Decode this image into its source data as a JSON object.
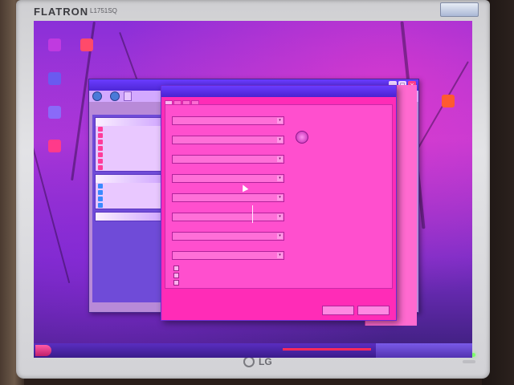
{
  "monitor": {
    "brand": "FLATRON",
    "model": "L1751SQ",
    "badge": "",
    "logo": "LG"
  },
  "desktop": {
    "icons": [
      {
        "label": "",
        "icon": "computer-icon",
        "color": "#c03ae0"
      },
      {
        "label": "",
        "icon": "documents-icon",
        "color": "#ff4a6a"
      },
      {
        "label": "",
        "icon": "network-icon",
        "color": "#6a5af0"
      },
      {
        "label": "",
        "icon": "recycle-bin-icon",
        "color": "#8a6af8"
      },
      {
        "label": "",
        "icon": "internet-icon",
        "color": "#ff3a8a"
      },
      {
        "label": "",
        "icon": "program-icon",
        "color": "#ff5a30"
      }
    ]
  },
  "explorer_window": {
    "title": "",
    "toolbar": {
      "back_label": "",
      "address_label": ""
    },
    "taskpane": {
      "sections": [
        {
          "header": "",
          "items": [
            "",
            "",
            "",
            "",
            "",
            "",
            ""
          ]
        },
        {
          "header": "",
          "items": [
            "",
            "",
            "",
            ""
          ]
        },
        {
          "header": "",
          "items": []
        }
      ]
    }
  },
  "dialog": {
    "title": "",
    "tabs": [
      "",
      "",
      "",
      ""
    ],
    "active_tab": 0,
    "fields": [
      {
        "label": "",
        "value": ""
      },
      {
        "label": "",
        "value": ""
      },
      {
        "label": "",
        "value": ""
      },
      {
        "label": "",
        "value": ""
      },
      {
        "label": "",
        "value": ""
      },
      {
        "label": "",
        "value": ""
      },
      {
        "label": "",
        "value": ""
      },
      {
        "label": "",
        "value": ""
      }
    ],
    "checkboxes": [
      {
        "label": "",
        "checked": false
      },
      {
        "label": "",
        "checked": false
      },
      {
        "label": "",
        "checked": false
      }
    ],
    "note": "",
    "buttons": {
      "ok": "",
      "cancel": ""
    },
    "status": ""
  },
  "side_panel": {
    "go_label": ""
  },
  "taskbar": {
    "start_label": "",
    "tray_text": ""
  },
  "colors": {
    "screen_tint": "#ff2cb7",
    "titlebar": "#5a30e8",
    "taskbar": "#4a24a8",
    "power_led": "#7dff6a"
  }
}
